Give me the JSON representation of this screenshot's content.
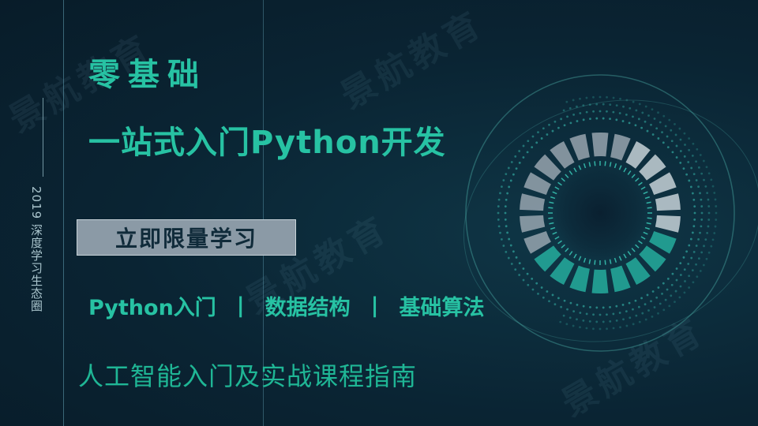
{
  "side": {
    "label": "2019 深度学习生态圈"
  },
  "headline": {
    "line1": "零基础",
    "line2": "一站式入门Python开发"
  },
  "cta": {
    "label": "立即限量学习"
  },
  "topics": {
    "items": [
      "Python入门",
      "数据结构",
      "基础算法"
    ],
    "separator": "|"
  },
  "subtitle": "人工智能入门及实战课程指南",
  "watermark": "景航教育",
  "colors": {
    "background": "#0b2535",
    "accent": "#27c2a3",
    "cta_bg": "#8b9aa6"
  }
}
